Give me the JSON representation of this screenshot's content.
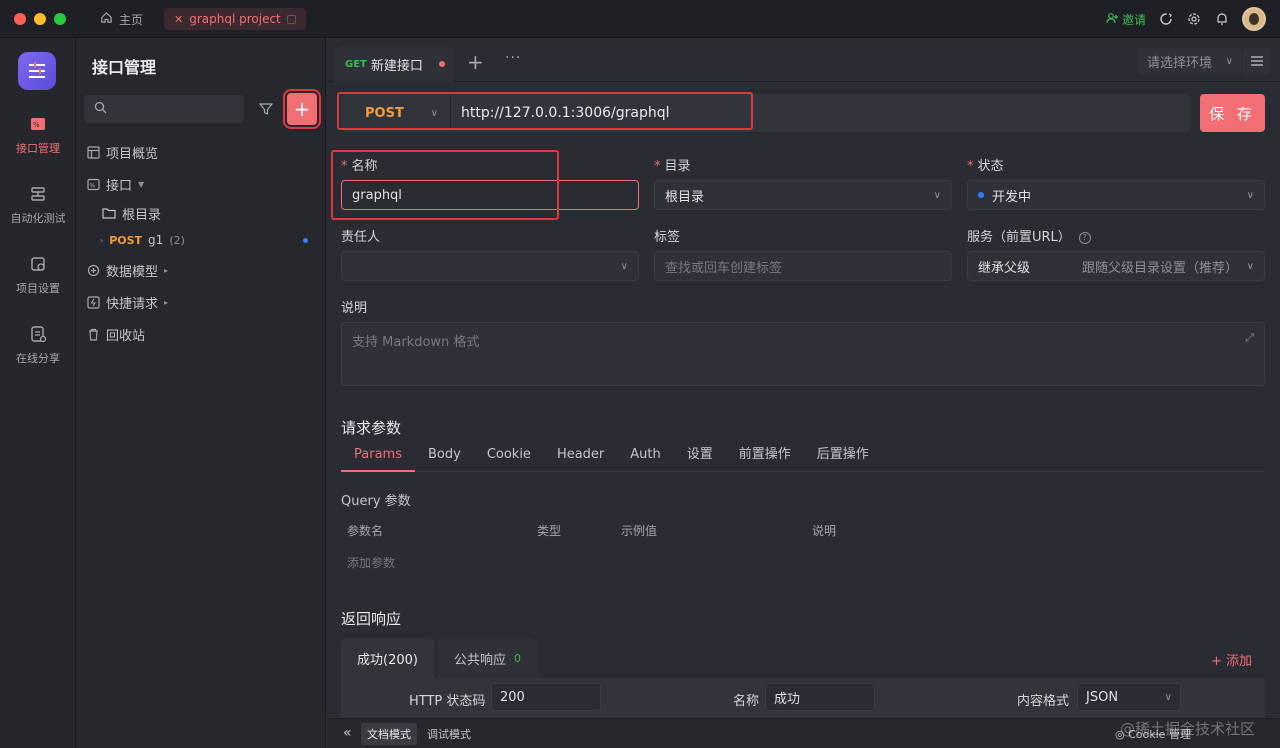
{
  "titlebar": {
    "home_label": "主页",
    "project_tab_label": "graphql project",
    "invite_label": "邀请"
  },
  "rail": {
    "items": [
      {
        "label": "接口管理",
        "icon": "api-icon"
      },
      {
        "label": "自动化测试",
        "icon": "automation-icon"
      },
      {
        "label": "项目设置",
        "icon": "project-settings-icon"
      },
      {
        "label": "在线分享",
        "icon": "share-icon"
      }
    ]
  },
  "sidebar": {
    "title": "接口管理",
    "tree": {
      "overview": "项目概览",
      "api": "接口",
      "root_folder": "根目录",
      "endpoint_method": "POST",
      "endpoint_name": "g1",
      "endpoint_count": "(2)",
      "data_models": "数据模型",
      "quick_request": "快捷请求",
      "recycle_bin": "回收站"
    }
  },
  "tabs": {
    "active_tab_method": "GET",
    "active_tab_label": "新建接口",
    "env_placeholder": "请选择环境"
  },
  "request": {
    "method": "POST",
    "url": "http://127.0.0.1:3006/graphql",
    "save_label": "保 存"
  },
  "form": {
    "name_label": "名称",
    "name_value": "graphql",
    "folder_label": "目录",
    "folder_value": "根目录",
    "status_label": "状态",
    "status_value": "开发中",
    "owner_label": "责任人",
    "tags_label": "标签",
    "tags_placeholder": "查找或回车创建标签",
    "service_label": "服务（前置URL）",
    "service_left": "继承父级",
    "service_right": "跟随父级目录设置（推荐）",
    "desc_label": "说明",
    "desc_placeholder": "支持 Markdown 格式"
  },
  "params": {
    "section_title": "请求参数",
    "tabs": [
      "Params",
      "Body",
      "Cookie",
      "Header",
      "Auth",
      "设置",
      "前置操作",
      "后置操作"
    ],
    "query_title": "Query 参数",
    "columns": [
      "参数名",
      "类型",
      "示例值",
      "说明"
    ],
    "add_param": "添加参数"
  },
  "response": {
    "section_title": "返回响应",
    "tab_success": "成功(200)",
    "tab_public": "公共响应",
    "tab_public_count": "0",
    "add_label": "+ 添加",
    "http_code_label": "HTTP 状态码",
    "http_code_value": "200",
    "name_label": "名称",
    "name_value": "成功",
    "format_label": "内容格式",
    "format_value": "JSON"
  },
  "bottombar": {
    "doc_mode": "文档模式",
    "debug_mode": "调试模式",
    "cookie_mgr": "Cookie 管理"
  },
  "watermark": "@稀土掘金技术社区",
  "colors": {
    "accent": "#f06e74",
    "post": "#f39c3c",
    "get": "#3fb950",
    "highlight": "#e0363e"
  }
}
